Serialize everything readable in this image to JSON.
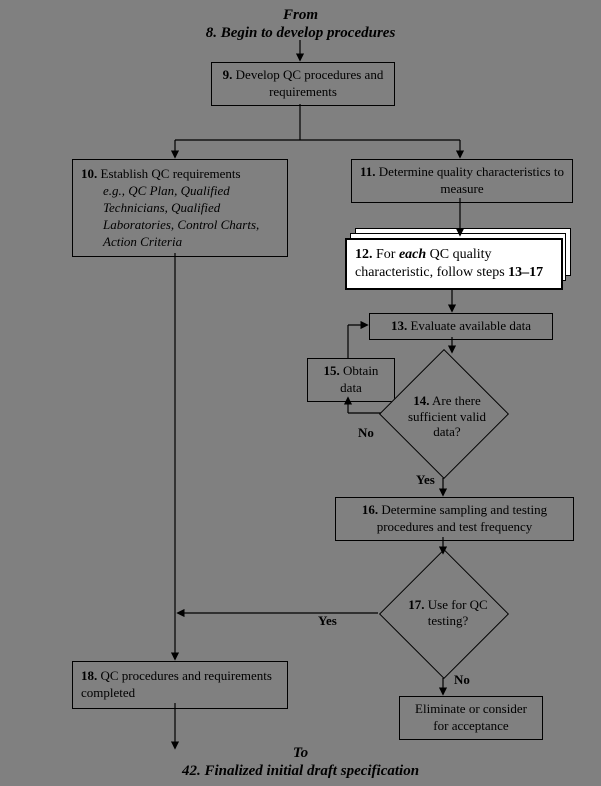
{
  "header": {
    "from": "From",
    "line": "8. Begin to develop procedures"
  },
  "b9": {
    "num": "9.",
    "text": " Develop QC procedures and requirements"
  },
  "b10": {
    "num": "10.",
    "text": " Establish QC requirements",
    "sub": "e.g., QC Plan, Qualified Technicians, Qualified Laboratories, Control Charts, Action Criteria"
  },
  "b11": {
    "num": "11.",
    "text": " Determine quality characteristics to measure"
  },
  "b12": {
    "num": "12.",
    "pre": " For ",
    "each": "each",
    "post": " QC quality characteristic, follow steps ",
    "range": "13–17"
  },
  "b13": {
    "num": "13.",
    "text": " Evaluate available data"
  },
  "b14": {
    "num": "14.",
    "text": " Are there sufficient valid data?"
  },
  "b15": {
    "num": "15.",
    "text": " Obtain data"
  },
  "b16": {
    "num": "16.",
    "text": " Determine sampling and testing procedures and test frequency"
  },
  "b17": {
    "num": "17.",
    "text": " Use for QC testing?"
  },
  "b18": {
    "num": "18.",
    "text": " QC procedures and requirements completed"
  },
  "belim": {
    "text": "Eliminate or consider for acceptance"
  },
  "yn": {
    "yes": "Yes",
    "no": "No"
  },
  "footer": {
    "to": "To",
    "line": "42. Finalized initial draft specification"
  }
}
